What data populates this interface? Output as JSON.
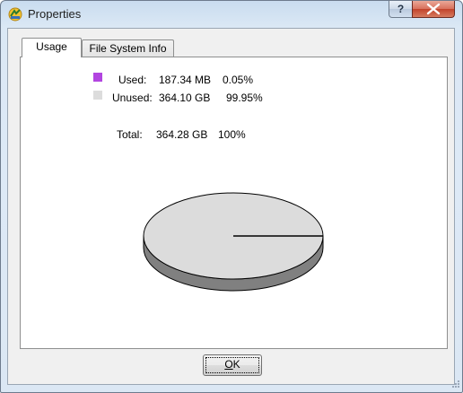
{
  "window": {
    "title": "Properties",
    "help_label": "?",
    "close_label": "✕"
  },
  "tabs": [
    {
      "label": "Usage",
      "selected": true
    },
    {
      "label": "File System Info",
      "selected": false
    }
  ],
  "usage": {
    "used": {
      "label": "Used:",
      "size": "187.34 MB",
      "percent": "0.05%",
      "color": "#b245e0"
    },
    "unused": {
      "label": "Unused:",
      "size": "364.10 GB",
      "percent": "99.95%",
      "color": "#dcdcdc"
    },
    "total": {
      "label": "Total:",
      "size": "364.28 GB",
      "percent": "100%"
    }
  },
  "chart_data": {
    "type": "pie",
    "categories": [
      "Used",
      "Unused"
    ],
    "values": [
      0.05,
      99.95
    ],
    "colors": [
      "#b245e0",
      "#dcdcdc"
    ]
  },
  "buttons": {
    "ok_mnemonic": "O",
    "ok_rest": "K"
  }
}
